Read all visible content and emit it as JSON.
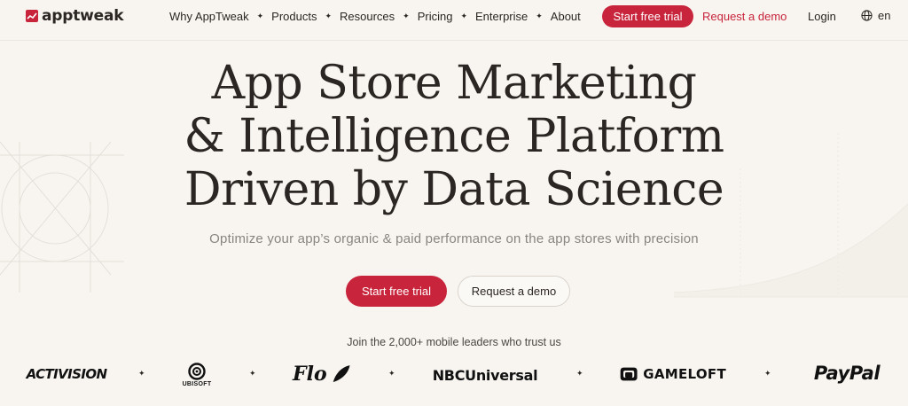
{
  "brand": {
    "name": "apptweak"
  },
  "nav": {
    "items": [
      {
        "label": "Why AppTweak"
      },
      {
        "label": "Products"
      },
      {
        "label": "Resources"
      },
      {
        "label": "Pricing"
      },
      {
        "label": "Enterprise"
      },
      {
        "label": "About"
      }
    ],
    "separator": "✦",
    "trial_label": "Start free trial",
    "demo_label": "Request a demo",
    "login_label": "Login",
    "language": "en"
  },
  "hero": {
    "title_lines": [
      "App Store Marketing",
      "& Intelligence Platform",
      "Driven by Data Science"
    ],
    "subtitle": "Optimize your app’s organic & paid performance on the app stores with precision",
    "trial_label": "Start free trial",
    "demo_label": "Request a demo"
  },
  "trust": {
    "text": "Join the 2,000+ mobile leaders who trust us",
    "brands": [
      "ACTIVISION",
      "UBISOFT",
      "Flo",
      "NBCUniversal",
      "GAMELOFT",
      "PayPal"
    ]
  },
  "colors": {
    "accent": "#c8243b",
    "background": "#f8f5f1",
    "text": "#2b2623",
    "muted": "#8a847e"
  }
}
